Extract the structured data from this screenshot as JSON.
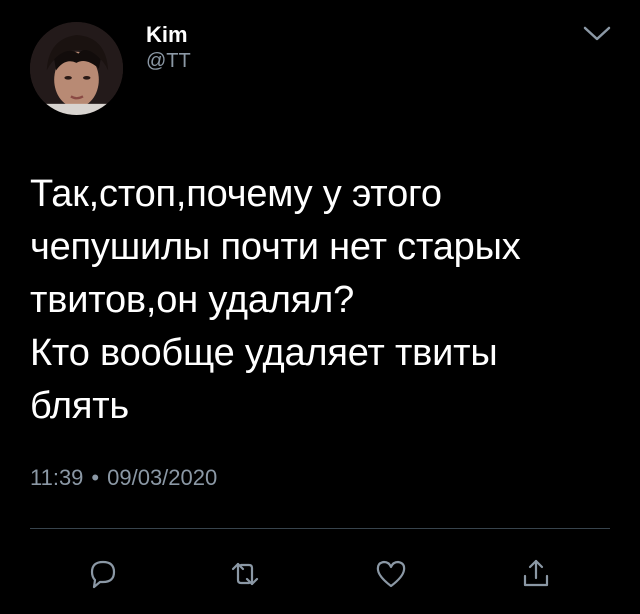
{
  "author": {
    "display_name": "Kim",
    "handle": "@TT"
  },
  "tweet": {
    "text": "Так,стоп,почему у этого\nчепушилы почти нет старых\nтвитов,он удалял?\nКто вообще удаляет твиты\nблять",
    "time": "11:39",
    "separator": "•",
    "date": "09/03/2020"
  },
  "icons": {
    "menu": "chevron-down-icon",
    "reply": "reply-icon",
    "retweet": "retweet-icon",
    "like": "heart-icon",
    "share": "share-icon"
  },
  "colors": {
    "background": "#000000",
    "text": "#ffffff",
    "secondary_text": "#8b98a5",
    "divider": "#38444d",
    "icon": "#8b98a5"
  }
}
